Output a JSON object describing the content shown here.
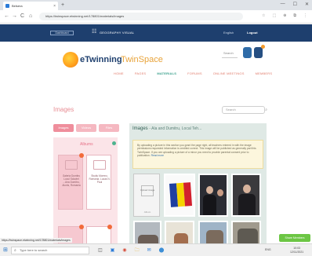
{
  "browser": {
    "tab_title": "Belsera",
    "tab_close": "×",
    "new_tab": "+",
    "window_controls": [
      "—",
      "☐",
      "✕"
    ],
    "url": "https://twinspace.etwinning.net/178801/materials/images",
    "nav": [
      "←",
      "→",
      "C",
      "⌂"
    ],
    "toolbar_icons": [
      "☆",
      "⬚",
      "⊕",
      "⧉",
      "⋮"
    ]
  },
  "sitebar": {
    "dashboard": "Dashboard",
    "twinspace_selector": "GEOGRAPHY VISUAL",
    "language": "English",
    "logout": "Logout"
  },
  "header": {
    "logo_part1": "eTwinning",
    "logo_part2": "TwinSpace",
    "search_label": "Search"
  },
  "menu": {
    "items": [
      "HOME",
      "PAGES",
      "MATERIALS",
      "FORUMS",
      "ONLINE MEETINGS",
      "MEMBERS"
    ]
  },
  "left": {
    "title": "Images",
    "pills": [
      "Images",
      "Videos",
      "Files"
    ],
    "album_title": "Albums",
    "folder1_text": "Galeria Dumitru Locul Sclaviei ...Ana Dumitru, Alunis, Romania",
    "folder2_text": "Studiu Moreno, Romania, Lucas N. Paul"
  },
  "right": {
    "search_placeholder": "Search",
    "title": "Images",
    "title_sub": "- Ala and Dumitru, Local Teh...",
    "notice": "By uploading a picture in this section you grant the page right, all teachers entered in with the image permissions requested information is credited correct. This image will be published as generally part this TwinSpace. If you are uploading a picture of a minor you need to provide parental consent prior to publication.",
    "notice_link": "Read more",
    "upload_caption": "Upload image",
    "upload_sub": "Album"
  },
  "status": {
    "hover_url": "https://twinspace.etwinning.net/178801/materials/images",
    "share": "Share Members"
  },
  "taskbar": {
    "start": "⊞",
    "search_text": "Type here to search",
    "apps": [
      "◫",
      "▣",
      "◉",
      "🗀",
      "✉",
      "⬤"
    ],
    "tray": "ENG",
    "clock_time": "10:03",
    "clock_date": "12/11/2021"
  },
  "colors": {
    "sitebar": "#1e3f6e",
    "accent_pink": "#ef8e9c",
    "panel_green": "#dfe9e5"
  }
}
